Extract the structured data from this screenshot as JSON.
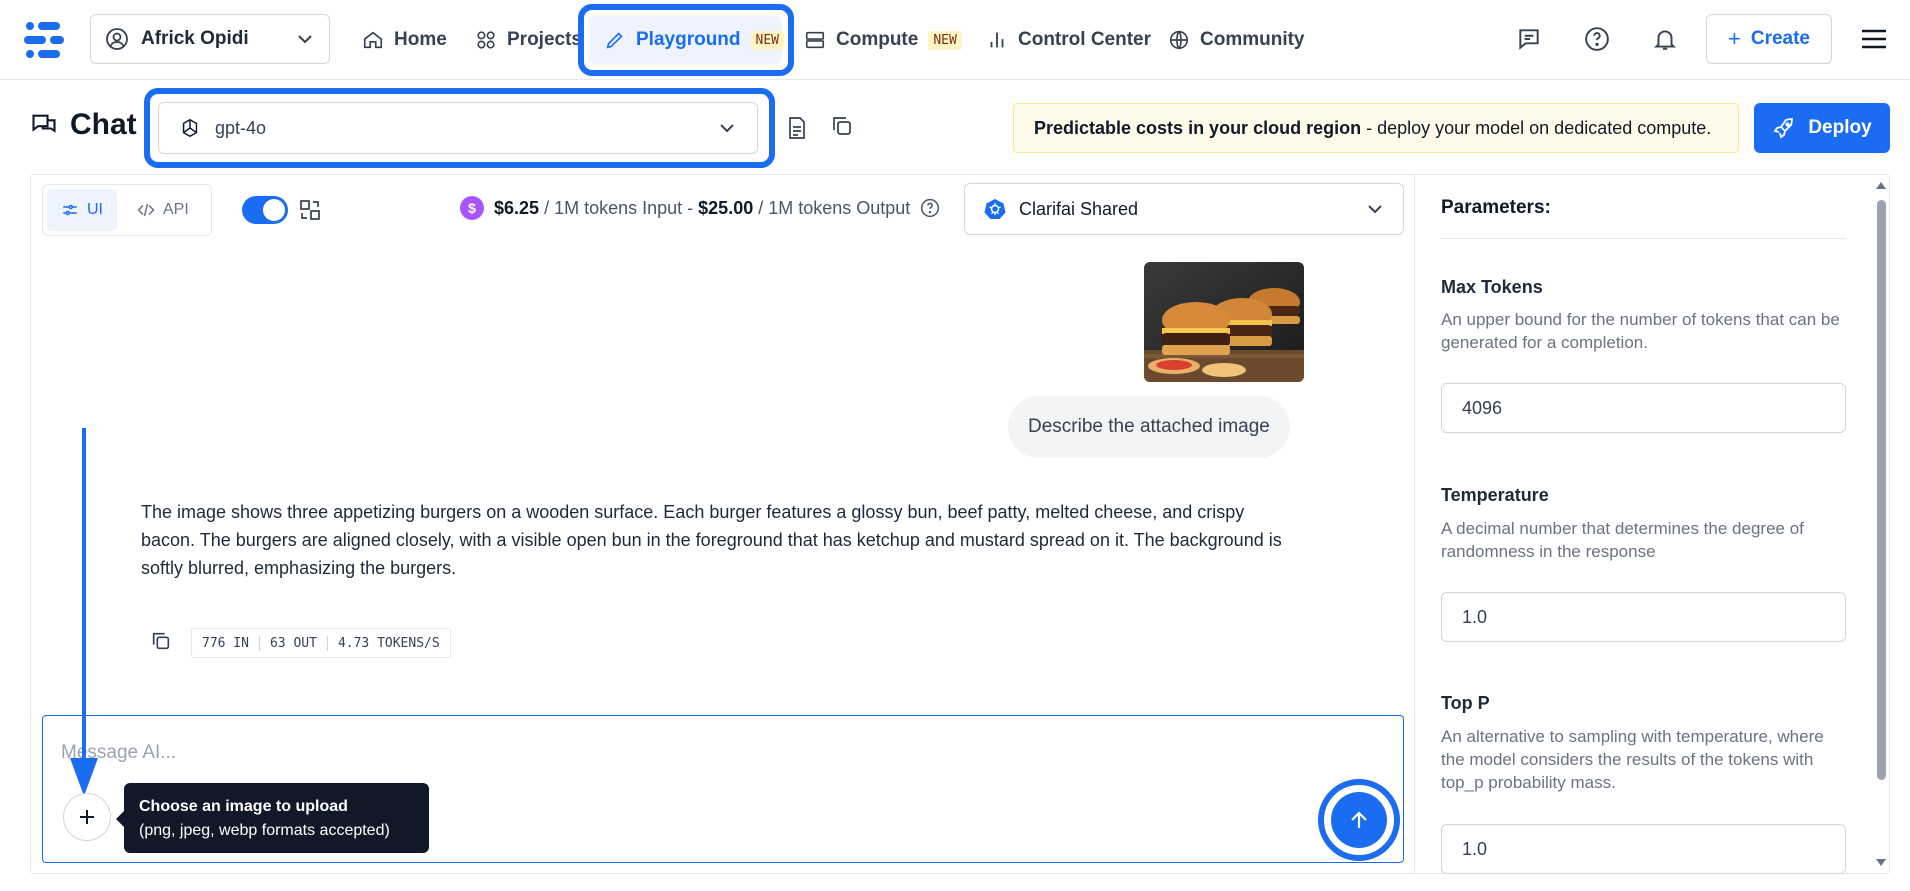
{
  "nav": {
    "account_name": "Africk Opidi",
    "home": "Home",
    "projects": "Projects",
    "playground": "Playground",
    "playground_badge": "NEW",
    "compute": "Compute",
    "compute_badge": "NEW",
    "control_center": "Control Center",
    "community": "Community",
    "create": "Create",
    "icons": [
      "chat-icon",
      "help-icon",
      "bell-icon",
      "menu-icon"
    ]
  },
  "header": {
    "title": "Chat",
    "model": "gpt-4o",
    "promo_bold": "Predictable costs in your cloud region",
    "promo_rest": " - deploy your model on dedicated compute.",
    "deploy": "Deploy"
  },
  "chat": {
    "tabs": [
      {
        "label": "UI",
        "active": true
      },
      {
        "label": "API",
        "active": false
      }
    ],
    "pricing": {
      "input_price": "$6.25",
      "input_unit": "/ 1M tokens Input -",
      "output_price": "$25.00",
      "output_unit": "/ 1M tokens Output"
    },
    "compute": "Clarifai Shared",
    "user_message": "Describe the attached image",
    "ai_message": "The image shows three appetizing burgers on a wooden surface. Each burger features a glossy bun, beef patty, melted cheese, and crispy bacon. The burgers are aligned closely, with a visible open bun in the foreground that has ketchup and mustard spread on it. The background is softly blurred, emphasizing the burgers.",
    "stats": {
      "in": "776 IN",
      "out": "63 OUT",
      "rate": "4.73 TOKENS/S"
    },
    "composer_placeholder": "Message AI...",
    "tooltip_title": "Choose an image to upload",
    "tooltip_sub": "(png, jpeg, webp formats accepted)"
  },
  "params": {
    "title": "Parameters:",
    "items": [
      {
        "label": "Max Tokens",
        "desc": "An upper bound for the number of tokens that can be generated for a completion.",
        "value": "4096"
      },
      {
        "label": "Temperature",
        "desc": "A decimal number that determines the degree of randomness in the response",
        "value": "1.0"
      },
      {
        "label": "Top P",
        "desc": "An alternative to sampling with temperature, where the model considers the results of the tokens with top_p probability mass.",
        "value": "1.0"
      }
    ]
  },
  "colors": {
    "accent": "#1a6cf0",
    "promo_bg": "#fffbeb",
    "pricing_badge": "#a855f7"
  }
}
